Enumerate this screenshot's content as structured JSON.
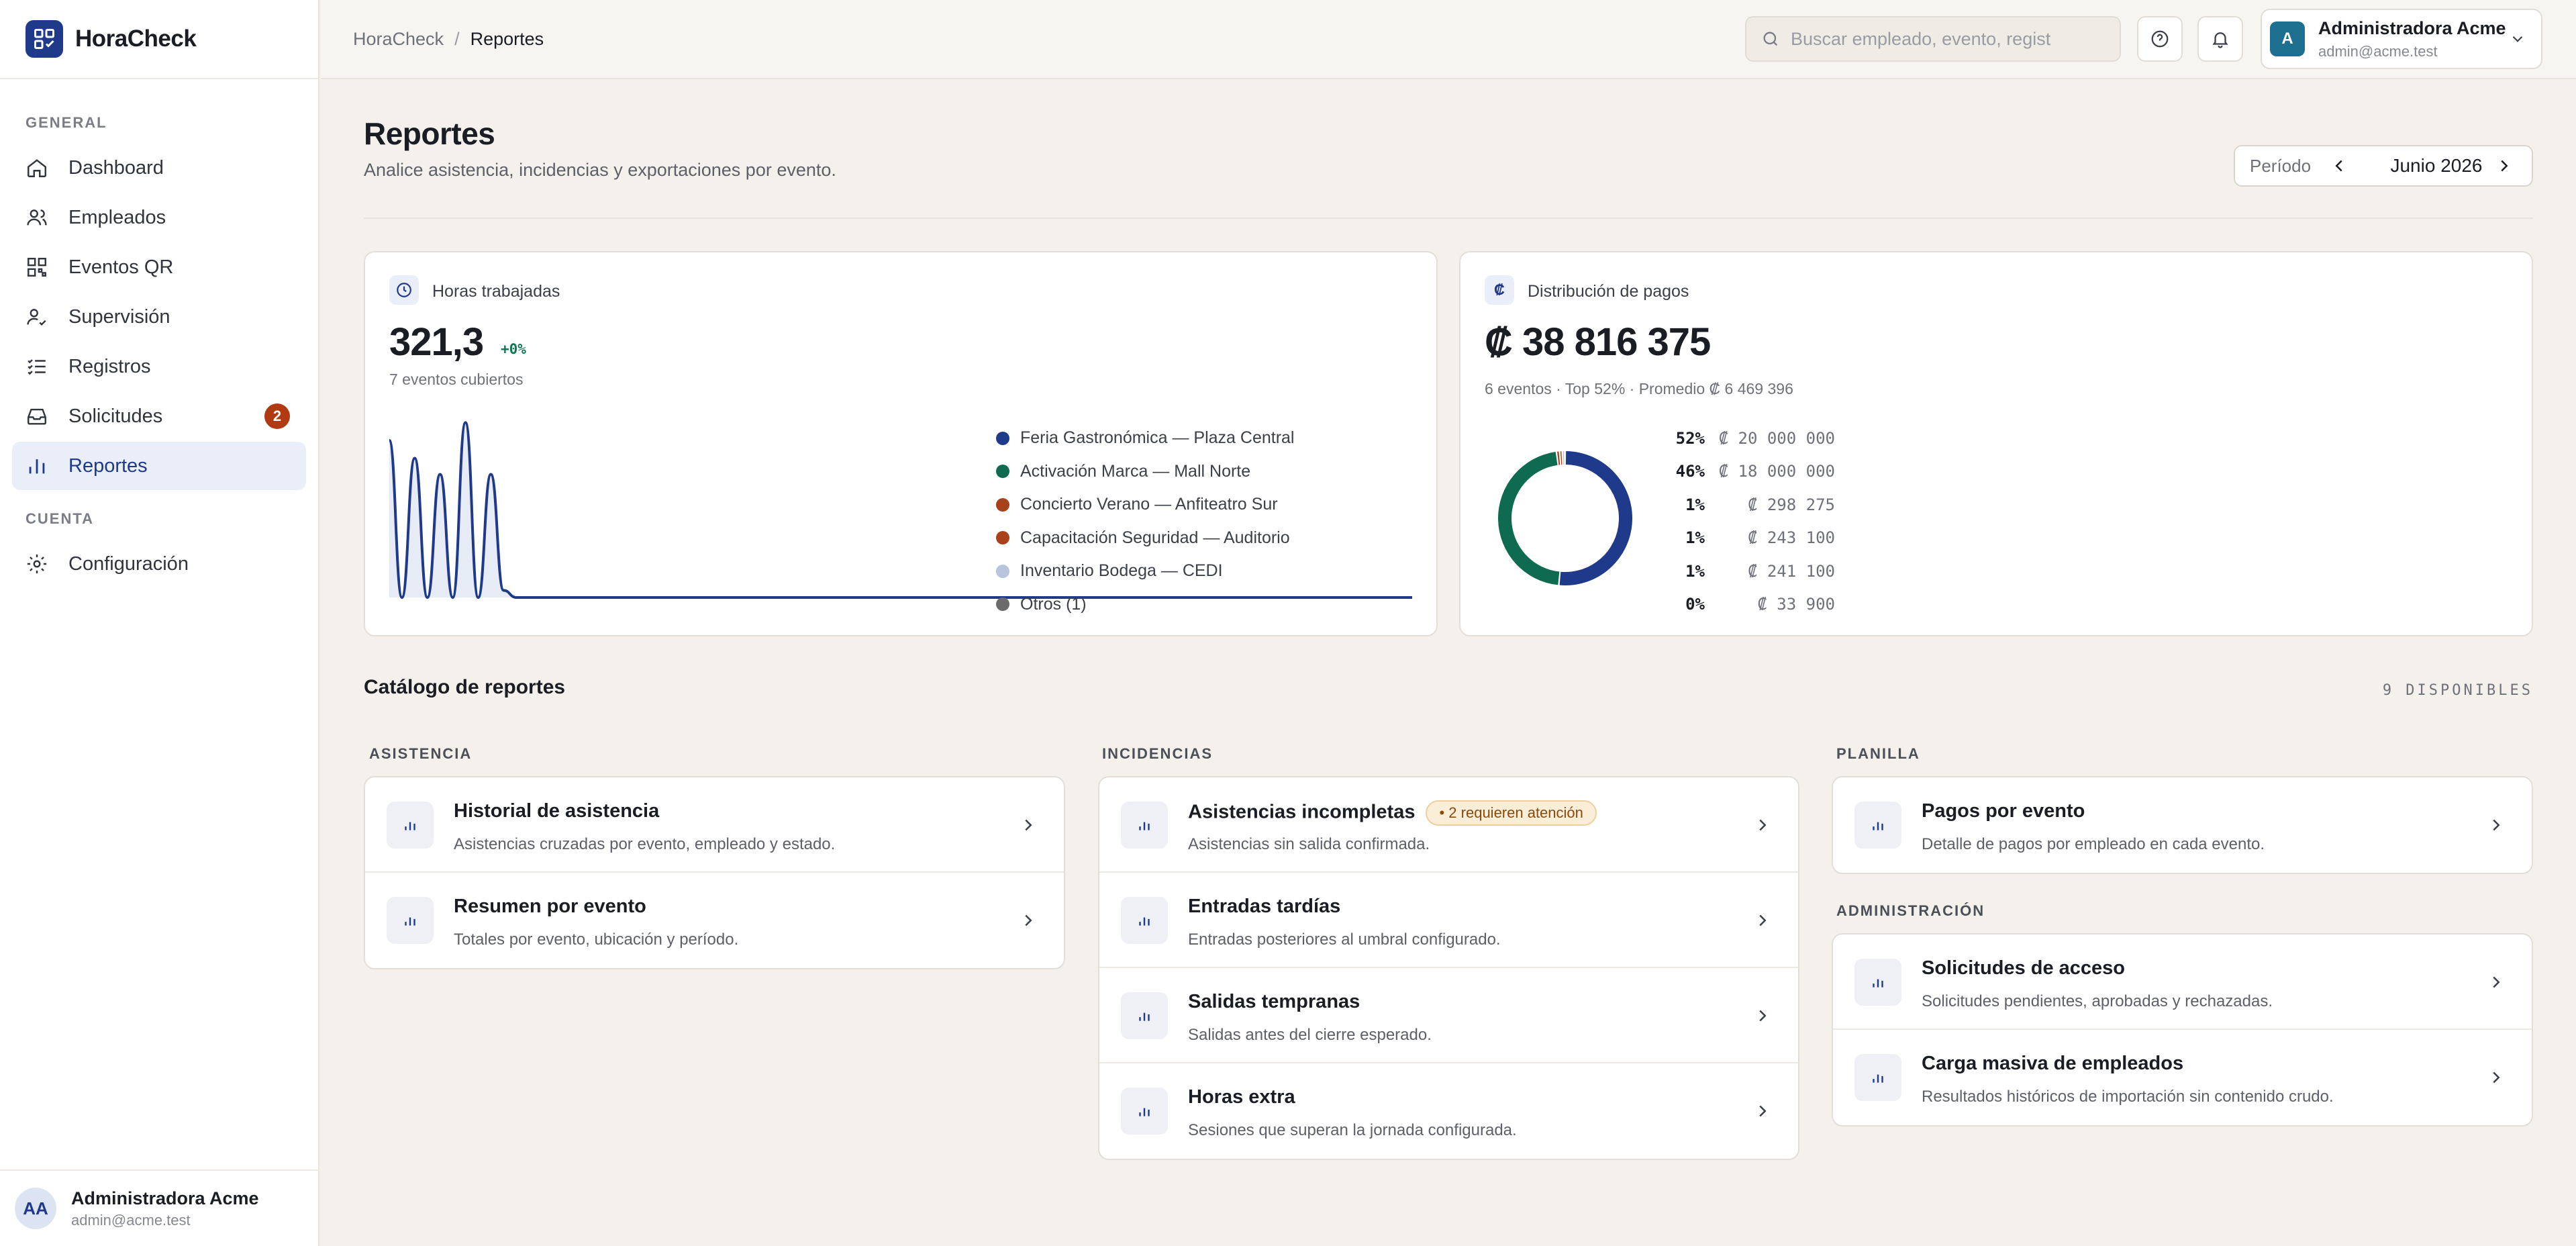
{
  "app": {
    "name": "HoraCheck"
  },
  "sidebar": {
    "section_general": "GENERAL",
    "section_account": "CUENTA",
    "items": [
      {
        "label": "Dashboard",
        "icon": "home-icon"
      },
      {
        "label": "Empleados",
        "icon": "users-icon"
      },
      {
        "label": "Eventos QR",
        "icon": "qr-grid-icon"
      },
      {
        "label": "Supervisión",
        "icon": "user-check-icon"
      },
      {
        "label": "Registros",
        "icon": "list-check-icon"
      },
      {
        "label": "Solicitudes",
        "icon": "inbox-icon",
        "badge": "2"
      },
      {
        "label": "Reportes",
        "icon": "bar-chart-icon",
        "active": true
      }
    ],
    "account_items": [
      {
        "label": "Configuración",
        "icon": "gear-icon"
      }
    ],
    "footer": {
      "initials": "AA",
      "name": "Administradora Acme",
      "email": "admin@acme.test"
    }
  },
  "header": {
    "breadcrumb": [
      "HoraCheck",
      "Reportes"
    ],
    "breadcrumb_sep": "/",
    "search_placeholder": "Buscar empleado, evento, regist",
    "user": {
      "initial": "A",
      "name": "Administradora Acme",
      "email": "admin@acme.test"
    }
  },
  "page": {
    "title": "Reportes",
    "subtitle": "Analice asistencia, incidencias y exportaciones por evento.",
    "period_label": "Período",
    "period_value": "Junio 2026"
  },
  "hours_card": {
    "label": "Horas trabajadas",
    "value": "321,3",
    "delta": "+0%",
    "meta": "7 eventos cubiertos"
  },
  "payments_card": {
    "label": "Distribución de pagos",
    "currency_icon": "₡",
    "value": "₡ 38 816 375",
    "meta": "6 eventos · Top 52% · Promedio ₡ 6 469 396",
    "colors": {
      "primary": "#1f3a8a",
      "green": "#0f6b4f",
      "rust": "#a8421a",
      "light": "#b8c4dc",
      "grey": "#6b6b6b"
    }
  },
  "chart_data": [
    {
      "type": "area",
      "series": [
        {
          "values": [
            88,
            0,
            78,
            0,
            69,
            0,
            98,
            0,
            69,
            4,
            0,
            0,
            0,
            0,
            0,
            0,
            0,
            0,
            0,
            0,
            0,
            0,
            0,
            0,
            0,
            0,
            0,
            0,
            0,
            0
          ]
        }
      ],
      "grid": false
    },
    {
      "type": "pie",
      "title": "",
      "slices": [
        {
          "label": "Feria Gastronómica — Plaza Central",
          "pct": "52%",
          "amount": "₡ 20 000 000",
          "value": 20000000,
          "color": "#1f3a8a"
        },
        {
          "label": "Activación Marca — Mall Norte",
          "pct": "46%",
          "amount": "₡ 18 000 000",
          "value": 18000000,
          "color": "#0f6b4f"
        },
        {
          "label": "Concierto Verano — Anfiteatro Sur",
          "pct": "1%",
          "amount": "₡ 298 275",
          "value": 298275,
          "color": "#a8421a"
        },
        {
          "label": "Capacitación Seguridad — Auditorio",
          "pct": "1%",
          "amount": "₡ 243 100",
          "value": 243100,
          "color": "#a8421a"
        },
        {
          "label": "Inventario Bodega — CEDI",
          "pct": "1%",
          "amount": "₡ 241 100",
          "value": 241100,
          "color": "#b8c4dc"
        },
        {
          "label": "Otros (1)",
          "pct": "0%",
          "amount": "₡ 33 900",
          "value": 33900,
          "color": "#6b6b6b"
        }
      ]
    }
  ],
  "catalog": {
    "title": "Catálogo de reportes",
    "count": "9 DISPONIBLES",
    "groups": {
      "asistencia": {
        "title": "ASISTENCIA",
        "items": [
          {
            "title": "Historial de asistencia",
            "desc": "Asistencias cruzadas por evento, empleado y estado."
          },
          {
            "title": "Resumen por evento",
            "desc": "Totales por evento, ubicación y período."
          }
        ]
      },
      "incidencias": {
        "title": "INCIDENCIAS",
        "items": [
          {
            "title": "Asistencias incompletas",
            "badge": "• 2 requieren atención",
            "desc": "Asistencias sin salida confirmada."
          },
          {
            "title": "Entradas tardías",
            "desc": "Entradas posteriores al umbral configurado."
          },
          {
            "title": "Salidas tempranas",
            "desc": "Salidas antes del cierre esperado."
          },
          {
            "title": "Horas extra",
            "desc": "Sesiones que superan la jornada configurada."
          }
        ]
      },
      "planilla": {
        "title": "PLANILLA",
        "items": [
          {
            "title": "Pagos por evento",
            "desc": "Detalle de pagos por empleado en cada evento."
          }
        ]
      },
      "administracion": {
        "title": "ADMINISTRACIÓN",
        "items": [
          {
            "title": "Solicitudes de acceso",
            "desc": "Solicitudes pendientes, aprobadas y rechazadas."
          },
          {
            "title": "Carga masiva de empleados",
            "desc": "Resultados históricos de importación sin contenido crudo."
          }
        ]
      }
    }
  }
}
